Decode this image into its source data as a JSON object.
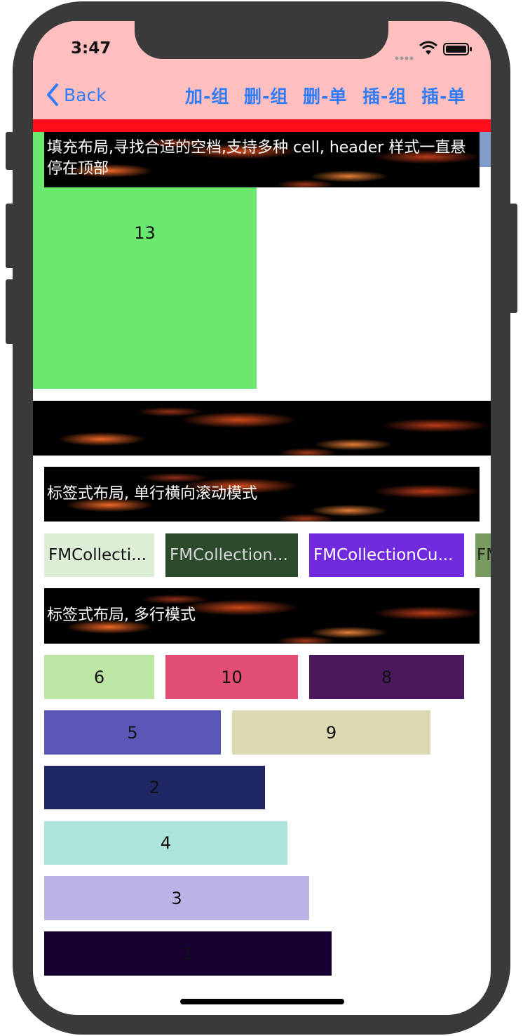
{
  "status_bar": {
    "time": "3:47"
  },
  "nav": {
    "back_label": "Back",
    "buttons": [
      "加-组",
      "删-组",
      "删-单",
      "插-组",
      "插-单"
    ]
  },
  "section1": {
    "header": "填充布局,寻找合适的空档,支持多种 cell, header 样式一直悬停在顶部",
    "cell_label": "13"
  },
  "section2": {
    "header": "标签式布局, 单行横向滚动模式"
  },
  "tags": [
    "FMCollecti...",
    "FMCollection...",
    "FMCollectionCu...",
    "FM"
  ],
  "section3": {
    "header": "标签式布局, 多行模式"
  },
  "numbers": [
    "6",
    "10",
    "8",
    "5",
    "9",
    "2",
    "4",
    "3",
    "1"
  ],
  "colors": {
    "nav_bg": "#ffbfbf",
    "accent": "#2f7cf6",
    "red_bar": "#ff0d1a",
    "cell13": "#6be870"
  }
}
